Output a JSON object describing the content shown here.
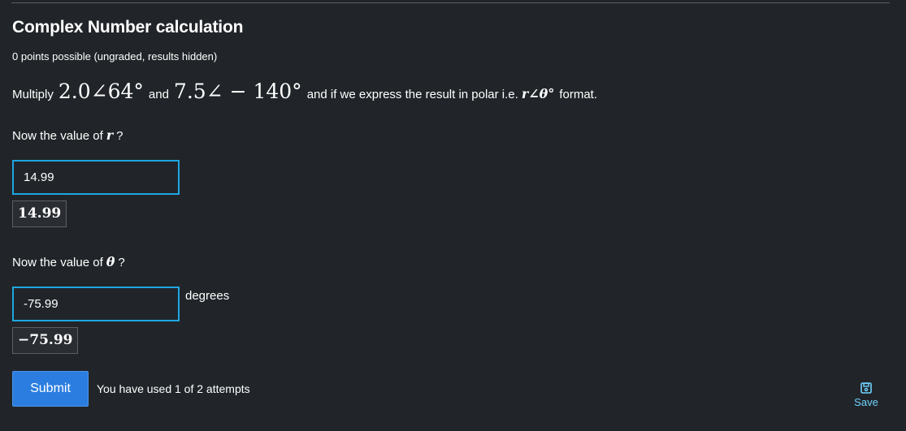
{
  "problem": {
    "title": "Complex Number calculation",
    "points": "0 points possible (ungraded, results hidden)",
    "question": {
      "prefix": "Multiply",
      "operand1": "2.0∠64°",
      "and": "and",
      "operand2": "7.5∠ − 140°",
      "suffix": "and if we express the result in polar i.e.",
      "format_expr": "r∠θ°",
      "format_word": "format."
    },
    "part1": {
      "prompt_prefix": "Now the value of",
      "variable": "r",
      "prompt_suffix": "?",
      "input_value": "14.99",
      "preview": "14.99"
    },
    "part2": {
      "prompt_prefix": "Now the value of",
      "variable": "θ",
      "prompt_suffix": "?",
      "input_value": "-75.99",
      "units": "degrees",
      "preview": "−75.99"
    },
    "actions": {
      "submit_label": "Submit",
      "attempts_text": "You have used 1 of 2 attempts",
      "save_label": "Save",
      "save_icon": "floppy-disk-icon"
    }
  },
  "colors": {
    "background": "#212529",
    "input_border": "#1ea7e1",
    "submit_bg": "#2b7ee0",
    "save_link": "#6fd3ff"
  }
}
